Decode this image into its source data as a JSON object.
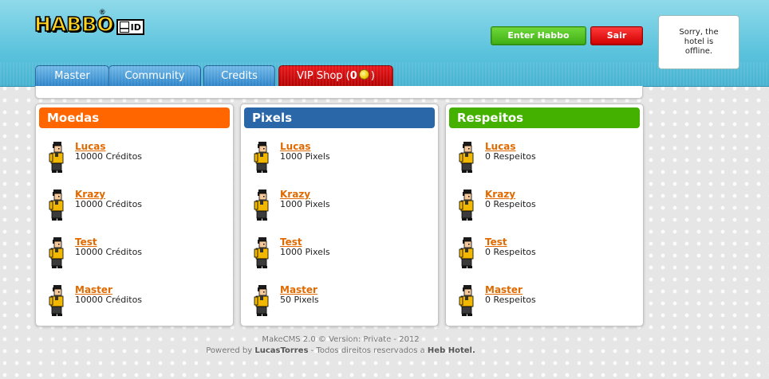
{
  "logo": {
    "text": "HABBO",
    "reg": "®",
    "badge": "ID"
  },
  "header": {
    "enter_label": "Enter Habbo",
    "exit_label": "Sair",
    "status": "Sorry, the hotel is offline."
  },
  "tabs": [
    {
      "label": "Master"
    },
    {
      "label": "Community"
    },
    {
      "label": "Credits"
    },
    {
      "label_prefix": "VIP Shop (",
      "count": "0",
      "label_suffix": ")"
    }
  ],
  "panels": [
    {
      "title": "Moedas",
      "color": "#ff6600",
      "rows": [
        {
          "name": "Lucas",
          "value": "10000 Créditos"
        },
        {
          "name": "Krazy",
          "value": "10000 Créditos"
        },
        {
          "name": "Test",
          "value": "10000 Créditos"
        },
        {
          "name": "Master",
          "value": "10000 Créditos"
        }
      ]
    },
    {
      "title": "Pixels",
      "color": "#2a67a8",
      "rows": [
        {
          "name": "Lucas",
          "value": "1000 Pixels"
        },
        {
          "name": "Krazy",
          "value": "1000 Pixels"
        },
        {
          "name": "Test",
          "value": "1000 Pixels"
        },
        {
          "name": "Master",
          "value": "50 Pixels"
        }
      ]
    },
    {
      "title": "Respeitos",
      "color": "#44b000",
      "rows": [
        {
          "name": "Lucas",
          "value": "0 Respeitos"
        },
        {
          "name": "Krazy",
          "value": "0 Respeitos"
        },
        {
          "name": "Test",
          "value": "0 Respeitos"
        },
        {
          "name": "Master",
          "value": "0 Respeitos"
        }
      ]
    }
  ],
  "footer": {
    "line1": "MakeCMS 2.0 © Version: Private - 2012",
    "line2_prefix": "Powered by ",
    "author": "LucasTorres",
    "line2_middle": " - Todos direitos reservados a ",
    "hotel": "Heb Hotel."
  }
}
